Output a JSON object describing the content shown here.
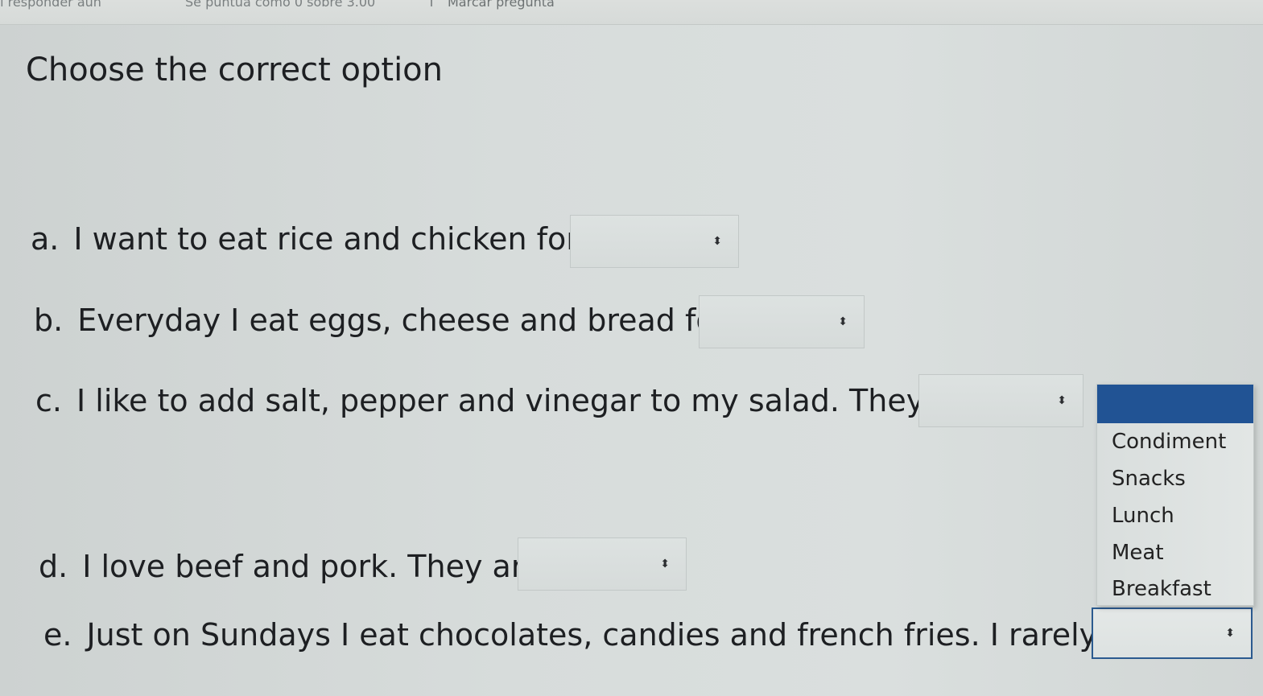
{
  "topbar": {
    "crumb_left": "ni responder aún",
    "crumb_middle": "Se puntúa como 0 sobre 3.00",
    "flag_label": "Marcar pregunta"
  },
  "title": "Choose the correct option",
  "questions": [
    {
      "letter": "a.",
      "text": "I want to eat rice and chicken for",
      "selected": ""
    },
    {
      "letter": "b.",
      "text": "Everyday I eat eggs, cheese and bread for",
      "selected": ""
    },
    {
      "letter": "c.",
      "text": "I like to add salt, pepper and vinegar to my salad. They are",
      "selected": ""
    },
    {
      "letter": "d.",
      "text": "I love beef and pork. They are",
      "selected": ""
    },
    {
      "letter": "e.",
      "text": "Just on Sundays I eat chocolates, candies and french fries. I rarely eat",
      "selected": ""
    }
  ],
  "select_arrow": "⬍",
  "dropdown": {
    "highlighted": "",
    "options": [
      "Condiment",
      "Snacks",
      "Lunch",
      "Meat",
      "Breakfast"
    ]
  }
}
